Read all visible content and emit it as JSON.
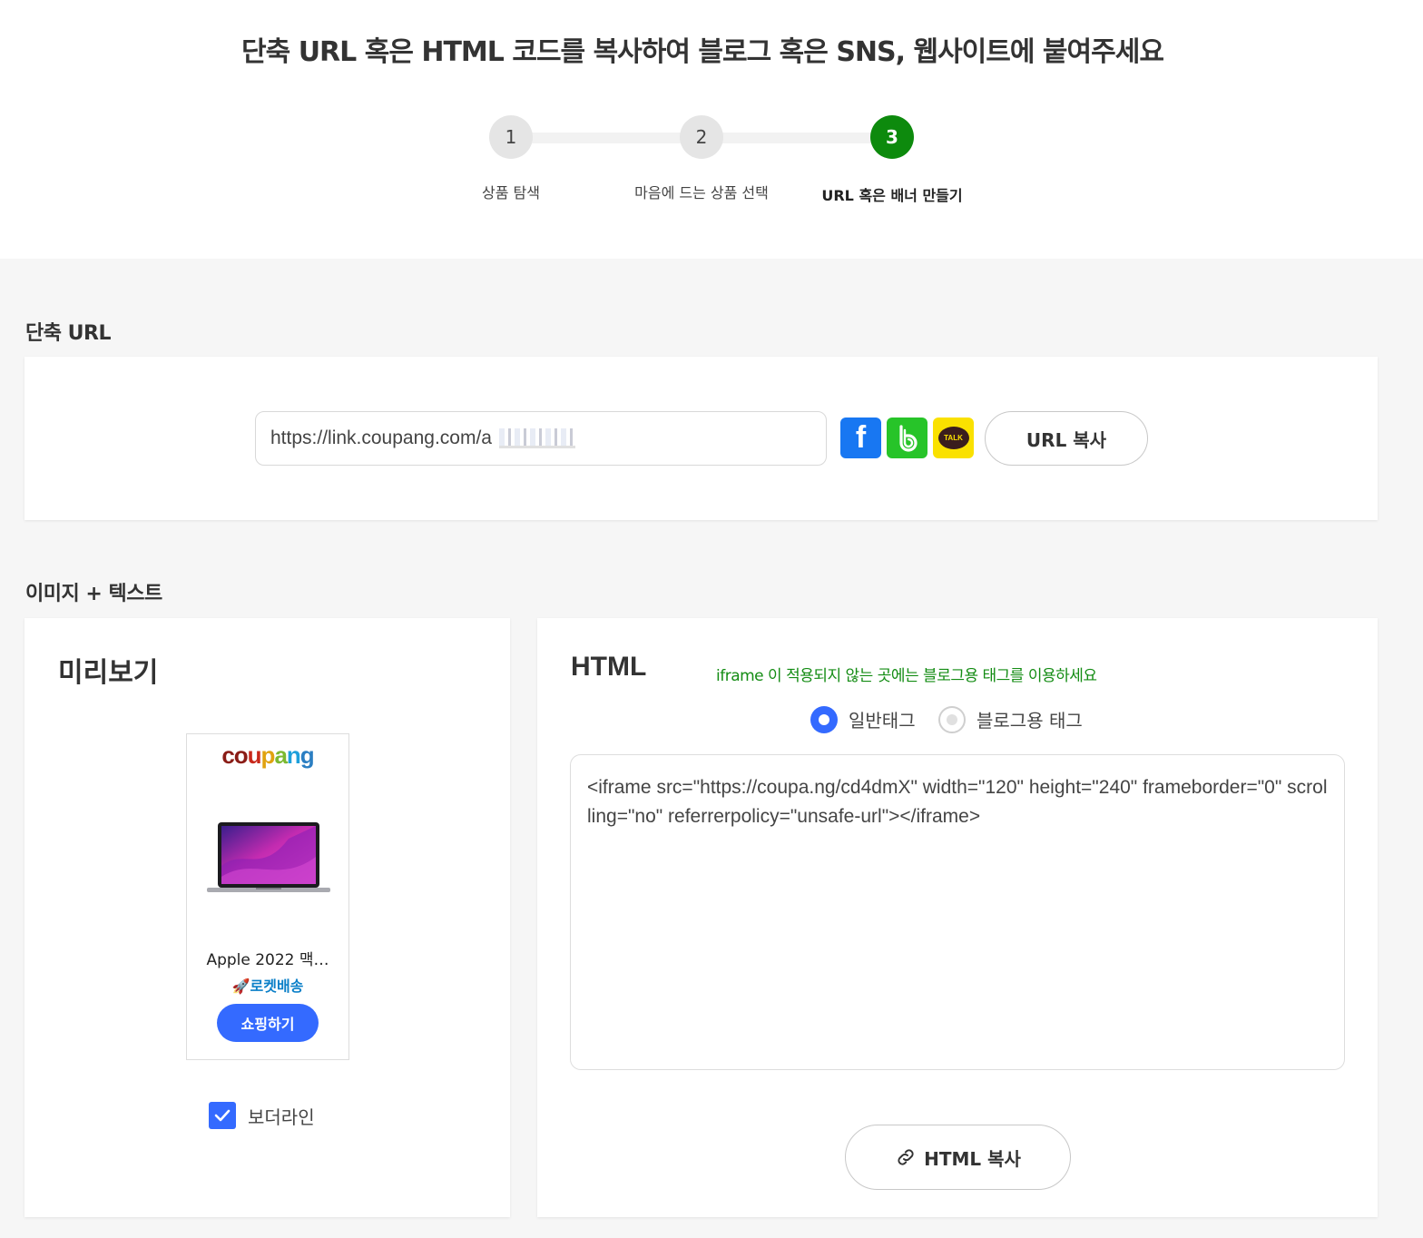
{
  "page_title": "단축 URL 혹은 HTML 코드를 복사하여 블로그 혹은 SNS, 웹사이트에 붙여주세요",
  "steps": [
    {
      "number": "1",
      "label": "상품 탐색",
      "active": false
    },
    {
      "number": "2",
      "label": "마음에 드는 상품 선택",
      "active": false
    },
    {
      "number": "3",
      "label": "URL 혹은 배너 만들기",
      "active": true
    }
  ],
  "short_url": {
    "section_title": "단축 URL",
    "url_value": "https://link.coupang.com/a",
    "share_icons": [
      "facebook-icon",
      "band-icon",
      "kakaotalk-icon"
    ],
    "kakao_text": "TALK",
    "facebook_glyph": "f",
    "copy_label": "URL 복사"
  },
  "image_text": {
    "section_title": "이미지 + 텍스트",
    "preview": {
      "title": "미리보기",
      "logo_letters": [
        "co",
        "u",
        "p",
        "a",
        "n",
        "g"
      ],
      "product_name": "Apple 2022 맥…",
      "rocket_icon": "🚀",
      "rocket_label": "로켓배송",
      "shop_button": "쇼핑하기",
      "border_checkbox_label": "보더라인",
      "border_checked": true
    },
    "html": {
      "title": "HTML",
      "hint": "iframe 이 적용되지 않는 곳에는 블로그용 태그를 이용하세요",
      "radio_options": [
        {
          "label": "일반태그",
          "selected": true
        },
        {
          "label": "블로그용 태그",
          "selected": false
        }
      ],
      "code": "<iframe src=\"https://coupa.ng/cd4dmX\" width=\"120\" height=\"240\" frameborder=\"0\" scrolling=\"no\" referrerpolicy=\"unsafe-url\"></iframe>",
      "copy_label": "HTML 복사"
    }
  },
  "colors": {
    "accent_blue": "#346aff",
    "step_active_green": "#0d8a0d",
    "hint_green": "#138c13",
    "rocket_blue": "#0a7fc8"
  }
}
